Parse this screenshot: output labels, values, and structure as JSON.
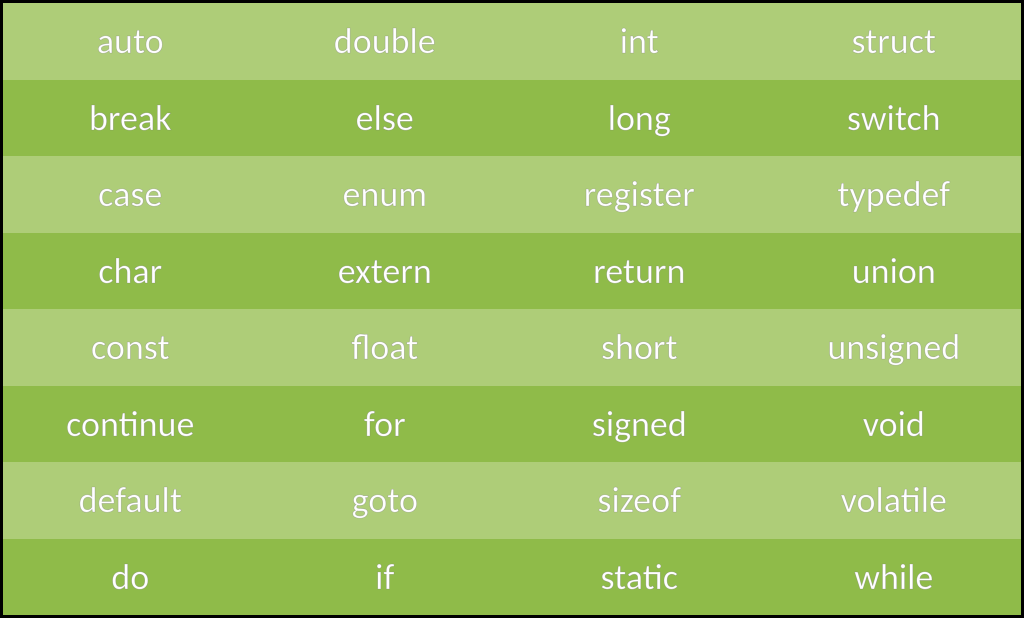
{
  "table": {
    "rows": [
      {
        "shade": "light",
        "cells": [
          "auto",
          "double",
          "int",
          "struct"
        ]
      },
      {
        "shade": "dark",
        "cells": [
          "break",
          "else",
          "long",
          "switch"
        ]
      },
      {
        "shade": "light",
        "cells": [
          "case",
          "enum",
          "register",
          "typedef"
        ]
      },
      {
        "shade": "dark",
        "cells": [
          "char",
          "extern",
          "return",
          "union"
        ]
      },
      {
        "shade": "light",
        "cells": [
          "const",
          "float",
          "short",
          "unsigned"
        ]
      },
      {
        "shade": "dark",
        "cells": [
          "continue",
          "for",
          "signed",
          "void"
        ]
      },
      {
        "shade": "light",
        "cells": [
          "default",
          "goto",
          "sizeof",
          "volatile"
        ]
      },
      {
        "shade": "dark",
        "cells": [
          "do",
          "if",
          "static",
          "while"
        ]
      }
    ]
  },
  "colors": {
    "light_row": "#aecd78",
    "dark_row": "#8fbb49",
    "text": "#ffffff",
    "border": "#000000"
  }
}
